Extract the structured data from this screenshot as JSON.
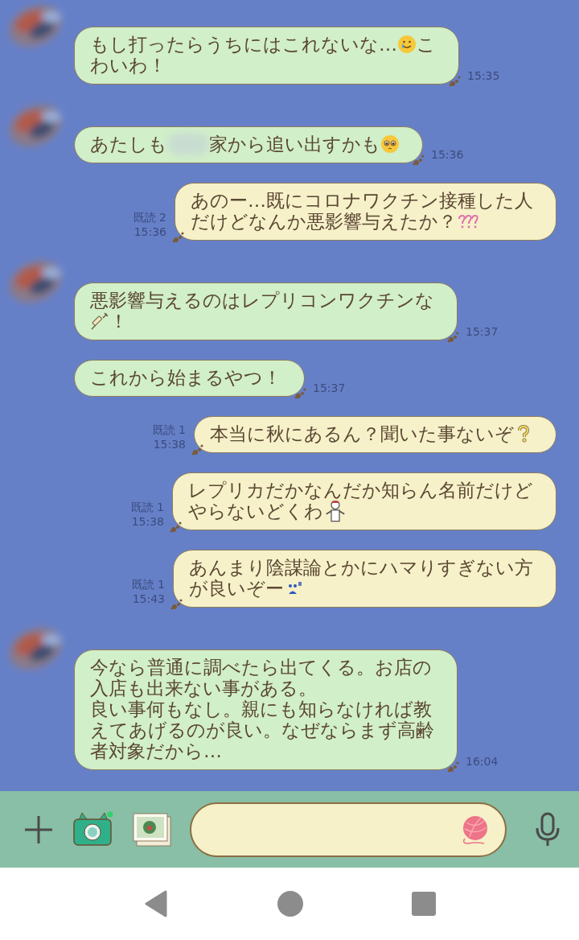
{
  "messages": [
    {
      "kind": "incoming",
      "avatar": true,
      "lines": [
        [
          {
            "kind": "text",
            "text": "もし打ったらうちにはこれないな…"
          },
          {
            "kind": "tear"
          },
          {
            "kind": "text",
            "text": "こ"
          }
        ],
        [
          {
            "kind": "text",
            "text": "わいわ！"
          }
        ]
      ],
      "time": "15:35"
    },
    {
      "kind": "incoming",
      "avatar": true,
      "lines": [
        [
          {
            "kind": "text",
            "text": "あたしも"
          },
          {
            "kind": "blur"
          },
          {
            "kind": "text",
            "text": "家から追い出すかも"
          },
          {
            "kind": "pleading"
          }
        ]
      ],
      "time": "15:36"
    },
    {
      "kind": "outgoing",
      "read": "既読 2",
      "lines": [
        [
          {
            "kind": "text",
            "text": "あのー…既にコロナワクチン接種した人"
          }
        ],
        [
          {
            "kind": "text",
            "text": "だけどなんか悪影響与えたか？"
          },
          {
            "kind": "questions"
          }
        ]
      ],
      "time": "15:36"
    },
    {
      "kind": "incoming",
      "avatar": true,
      "lines": [
        [
          {
            "kind": "text",
            "text": "悪影響与えるのはレプリコンワクチンな"
          }
        ],
        [
          {
            "kind": "syringe"
          },
          {
            "kind": "text",
            "text": "！"
          }
        ]
      ],
      "time": "15:37"
    },
    {
      "kind": "incoming",
      "avatar": false,
      "lines": [
        [
          {
            "kind": "text",
            "text": "これから始まるやつ！"
          }
        ]
      ],
      "time": "15:37"
    },
    {
      "kind": "outgoing",
      "read": "既読 1",
      "lines": [
        [
          {
            "kind": "text",
            "text": "本当に秋にあるん？聞いた事ないぞ"
          },
          {
            "kind": "question"
          }
        ]
      ],
      "time": "15:38"
    },
    {
      "kind": "outgoing",
      "read": "既読 1",
      "lines": [
        [
          {
            "kind": "text",
            "text": "レプリカだかなんだか知らん名前だけど"
          }
        ],
        [
          {
            "kind": "text",
            "text": "やらないどくわ"
          },
          {
            "kind": "figure"
          }
        ]
      ],
      "time": "15:38"
    },
    {
      "kind": "outgoing",
      "read": "既読 1",
      "lines": [
        [
          {
            "kind": "text",
            "text": "あんまり陰謀論とかにハマりすぎない方"
          }
        ],
        [
          {
            "kind": "text",
            "text": "が良いぞー"
          },
          {
            "kind": "sad"
          }
        ]
      ],
      "time": "15:43"
    },
    {
      "kind": "incoming",
      "avatar": true,
      "lines": [
        [
          {
            "kind": "text",
            "text": "今なら普通に調べたら出てくる。お店の"
          }
        ],
        [
          {
            "kind": "text",
            "text": "入店も出来ない事がある。"
          }
        ],
        [
          {
            "kind": "text",
            "text": "良い事何もなし。親にも知らなければ教"
          }
        ],
        [
          {
            "kind": "text",
            "text": "えてあげるのが良い。なぜならまず高齢"
          }
        ],
        [
          {
            "kind": "text",
            "text": "者対象だから…"
          }
        ]
      ],
      "time": "16:04"
    }
  ]
}
